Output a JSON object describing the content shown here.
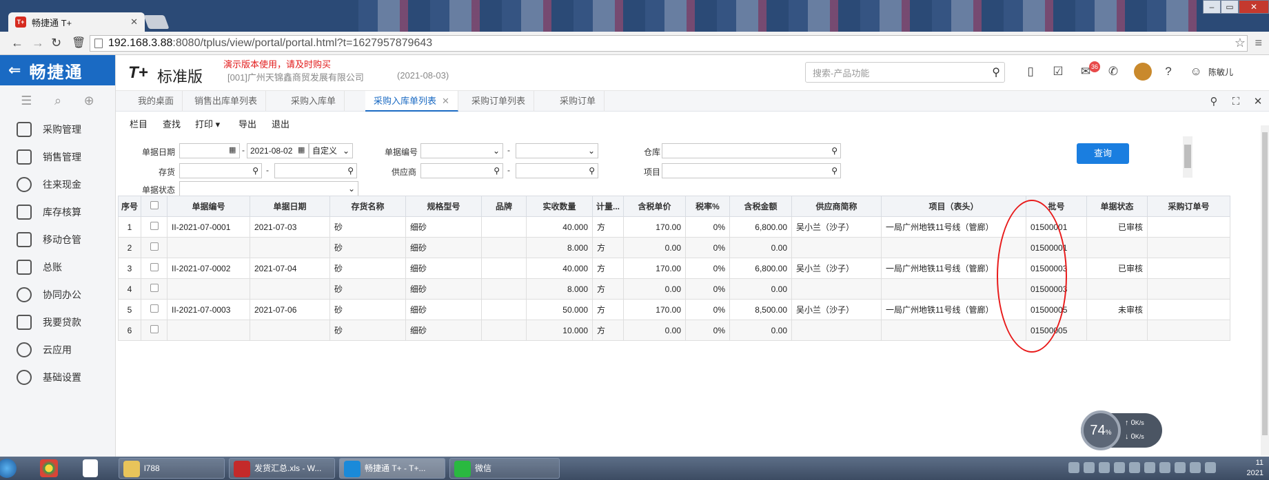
{
  "browser": {
    "tab_title": "畅捷通 T+",
    "tab_favicon": "T+",
    "url_host": "192.168.3.88",
    "url_rest": ":8080/tplus/view/portal/portal.html?t=1627957879643"
  },
  "app": {
    "brand": "畅捷通",
    "logo_text": "T+",
    "edition": "标准版",
    "demo_notice": "演示版本使用，请及时购买",
    "company": "[001]广州天锦鑫商贸发展有限公司",
    "date": "(2021-08-03)",
    "search_placeholder": "搜索-产品功能",
    "notification_count": "36",
    "user": "陈敏儿"
  },
  "sidebar": {
    "items": [
      {
        "label": "采购管理"
      },
      {
        "label": "销售管理"
      },
      {
        "label": "往来现金"
      },
      {
        "label": "库存核算"
      },
      {
        "label": "移动仓管"
      },
      {
        "label": "总账"
      },
      {
        "label": "协同办公"
      },
      {
        "label": "我要贷款"
      },
      {
        "label": "云应用"
      },
      {
        "label": "基础设置"
      }
    ]
  },
  "tabs": [
    {
      "label": "我的桌面"
    },
    {
      "label": "销售出库单列表"
    },
    {
      "label": "采购入库单"
    },
    {
      "label": "采购入库单列表"
    },
    {
      "label": "采购订单列表"
    },
    {
      "label": "采购订单"
    }
  ],
  "toolbar": {
    "columns": "栏目",
    "find": "查找",
    "print": "打印",
    "export": "导出",
    "exit": "退出"
  },
  "filter": {
    "doc_date_label": "单据日期",
    "doc_date_to": "2021-08-02",
    "date_mode": "自定义",
    "doc_no_label": "单据编号",
    "warehouse_label": "仓库",
    "inventory_label": "存货",
    "supplier_label": "供应商",
    "project_label": "项目",
    "status_label": "单据状态",
    "query_button": "查询"
  },
  "table": {
    "headers": [
      "序号",
      "单据编号",
      "单据日期",
      "存货名称",
      "规格型号",
      "品牌",
      "实收数量",
      "计量...",
      "含税单价",
      "税率%",
      "含税金额",
      "供应商简称",
      "项目（表头）",
      "批号",
      "单据状态",
      "采购订单号"
    ],
    "rows": [
      {
        "n": "1",
        "doc": "II-2021-07-0001",
        "date": "2021-07-03",
        "inv": "砂",
        "spec": "细砂",
        "brand": "",
        "qty": "40.000",
        "unit": "方",
        "price": "170.00",
        "tax": "0%",
        "amount": "6,800.00",
        "supplier": "吴小兰（沙子）",
        "project": "一局广州地铁11号线（管廊）",
        "batch": "01500001",
        "status": "已审核",
        "po": ""
      },
      {
        "n": "2",
        "doc": "",
        "date": "",
        "inv": "砂",
        "spec": "细砂",
        "brand": "",
        "qty": "8.000",
        "unit": "方",
        "price": "0.00",
        "tax": "0%",
        "amount": "0.00",
        "supplier": "",
        "project": "",
        "batch": "01500001",
        "status": "",
        "po": ""
      },
      {
        "n": "3",
        "doc": "II-2021-07-0002",
        "date": "2021-07-04",
        "inv": "砂",
        "spec": "细砂",
        "brand": "",
        "qty": "40.000",
        "unit": "方",
        "price": "170.00",
        "tax": "0%",
        "amount": "6,800.00",
        "supplier": "吴小兰（沙子）",
        "project": "一局广州地铁11号线（管廊）",
        "batch": "01500003",
        "status": "已审核",
        "po": ""
      },
      {
        "n": "4",
        "doc": "",
        "date": "",
        "inv": "砂",
        "spec": "细砂",
        "brand": "",
        "qty": "8.000",
        "unit": "方",
        "price": "0.00",
        "tax": "0%",
        "amount": "0.00",
        "supplier": "",
        "project": "",
        "batch": "01500003",
        "status": "",
        "po": ""
      },
      {
        "n": "5",
        "doc": "II-2021-07-0003",
        "date": "2021-07-06",
        "inv": "砂",
        "spec": "细砂",
        "brand": "",
        "qty": "50.000",
        "unit": "方",
        "price": "170.00",
        "tax": "0%",
        "amount": "8,500.00",
        "supplier": "吴小兰（沙子）",
        "project": "一局广州地铁11号线（管廊）",
        "batch": "01500005",
        "status": "未审核",
        "po": ""
      },
      {
        "n": "6",
        "doc": "",
        "date": "",
        "inv": "砂",
        "spec": "细砂",
        "brand": "",
        "qty": "10.000",
        "unit": "方",
        "price": "0.00",
        "tax": "0%",
        "amount": "0.00",
        "supplier": "",
        "project": "",
        "batch": "01500005",
        "status": "",
        "po": ""
      }
    ]
  },
  "netspeed": {
    "cpu": "74",
    "cpu_unit": "%",
    "up": "0",
    "down": "0",
    "unit": "K/s"
  },
  "taskbar": {
    "windows": [
      {
        "label": "l788"
      },
      {
        "label": "发货汇总.xls - W..."
      },
      {
        "label": "畅捷通 T+ - T+..."
      },
      {
        "label": "微信"
      }
    ],
    "clock_time": "11",
    "clock_date": "2021"
  },
  "colors": {
    "brand_blue": "#1a6ac3",
    "annotation_red": "#e81b1b",
    "demo_red": "#e21b1b"
  }
}
